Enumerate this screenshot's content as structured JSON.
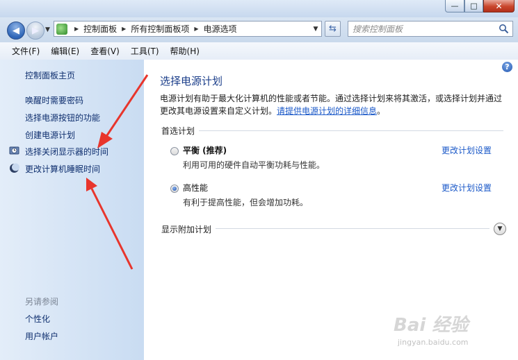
{
  "window": {
    "minimize_label": "—",
    "maximize_label": "□",
    "close_label": "✕"
  },
  "nav": {
    "back_glyph": "◀",
    "forward_glyph": "▶",
    "breadcrumbs": [
      "控制面板",
      "所有控制面板项",
      "电源选项"
    ],
    "search_placeholder": "搜索控制面板"
  },
  "menu": [
    "文件(F)",
    "编辑(E)",
    "查看(V)",
    "工具(T)",
    "帮助(H)"
  ],
  "sidebar": {
    "home": "控制面板主页",
    "links": [
      "唤醒时需要密码",
      "选择电源按钮的功能",
      "创建电源计划",
      "选择关闭显示器的时间",
      "更改计算机睡眠时间"
    ],
    "see_also": "另请参阅",
    "see_also_links": [
      "个性化",
      "用户帐户"
    ]
  },
  "main": {
    "help_glyph": "?",
    "title": "选择电源计划",
    "description": "电源计划有助于最大化计算机的性能或者节能。通过选择计划来将其激活，或选择计划并通过更改其电源设置来自定义计划。",
    "description_link": "请提供电源计划的详细信息",
    "description_end": "。",
    "preferred_label": "首选计划",
    "plans": [
      {
        "name": "平衡 (推荐)",
        "desc": "利用可用的硬件自动平衡功耗与性能。",
        "link": "更改计划设置",
        "selected": false
      },
      {
        "name": "高性能",
        "desc": "有利于提高性能，但会增加功耗。",
        "link": "更改计划设置",
        "selected": true
      }
    ],
    "additional_label": "显示附加计划"
  },
  "watermark": {
    "main": "Bai 经验",
    "sub": "jingyan.baidu.com"
  },
  "colors": {
    "arrow": "#e8352c",
    "link": "#1a58c8",
    "title": "#1b3e8a"
  }
}
